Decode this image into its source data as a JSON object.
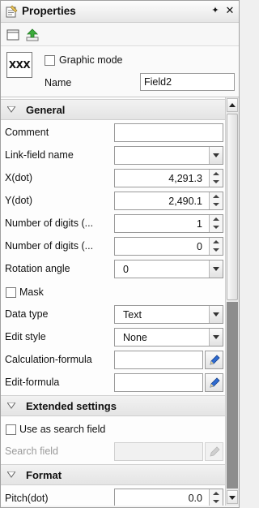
{
  "window": {
    "title": "Properties",
    "pin_glyph": "✦",
    "close_glyph": "✕",
    "icon": "properties-window-icon"
  },
  "toolbar": {
    "buttons": [
      {
        "icon": "object-frame-icon"
      },
      {
        "icon": "add-green-arrow-icon"
      }
    ]
  },
  "object": {
    "preview_text": "XXX",
    "graphic_mode_label": "Graphic mode",
    "graphic_mode_checked": false,
    "name_label": "Name",
    "name_value": "Field2"
  },
  "sections": {
    "general": "General",
    "extended": "Extended settings",
    "format": "Format"
  },
  "general": {
    "comment_label": "Comment",
    "comment_value": "",
    "link_field_label": "Link-field name",
    "link_field_value": "",
    "x_label": "X(dot)",
    "x_value": "4,291.3",
    "y_label": "Y(dot)",
    "y_value": "2,490.1",
    "digits1_label": "Number of digits (...",
    "digits1_value": "1",
    "digits2_label": "Number of digits (...",
    "digits2_value": "0",
    "rotation_label": "Rotation angle",
    "rotation_value": "0",
    "mask_label": "Mask",
    "mask_checked": false,
    "data_type_label": "Data type",
    "data_type_value": "Text",
    "edit_style_label": "Edit style",
    "edit_style_value": "None",
    "calc_formula_label": "Calculation-formula",
    "calc_formula_value": "",
    "edit_formula_label": "Edit-formula",
    "edit_formula_value": ""
  },
  "extended": {
    "search_field_check_label": "Use as search field",
    "search_field_checked": false,
    "search_field_label": "Search field",
    "search_field_value": ""
  },
  "format": {
    "pitch_label": "Pitch(dot)",
    "pitch_value": "0.0"
  },
  "colors": {
    "accent_blue": "#2b5db5",
    "edit_pencil": "#1f5fb8"
  }
}
